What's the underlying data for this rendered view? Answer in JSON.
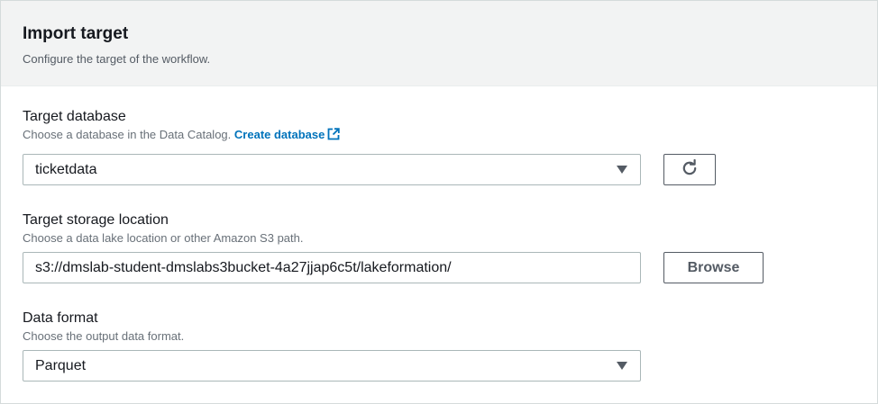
{
  "header": {
    "title": "Import target",
    "description": "Configure the target of the workflow."
  },
  "target_database": {
    "label": "Target database",
    "description": "Choose a database in the Data Catalog.",
    "link_text": "Create database",
    "selected_value": "ticketdata",
    "refresh_icon": "refresh-icon",
    "external_icon": "external-link-icon"
  },
  "target_storage": {
    "label": "Target storage location",
    "description": "Choose a data lake location or other Amazon S3 path.",
    "value": "s3://dmslab-student-dmslabs3bucket-4a27jjap6c5t/lakeformation/",
    "browse_label": "Browse"
  },
  "data_format": {
    "label": "Data format",
    "description": "Choose the output data format.",
    "selected_value": "Parquet"
  },
  "colors": {
    "link": "#0073bb",
    "header_bg": "#f2f3f3",
    "border": "#aab7b8",
    "text": "#16191f"
  }
}
